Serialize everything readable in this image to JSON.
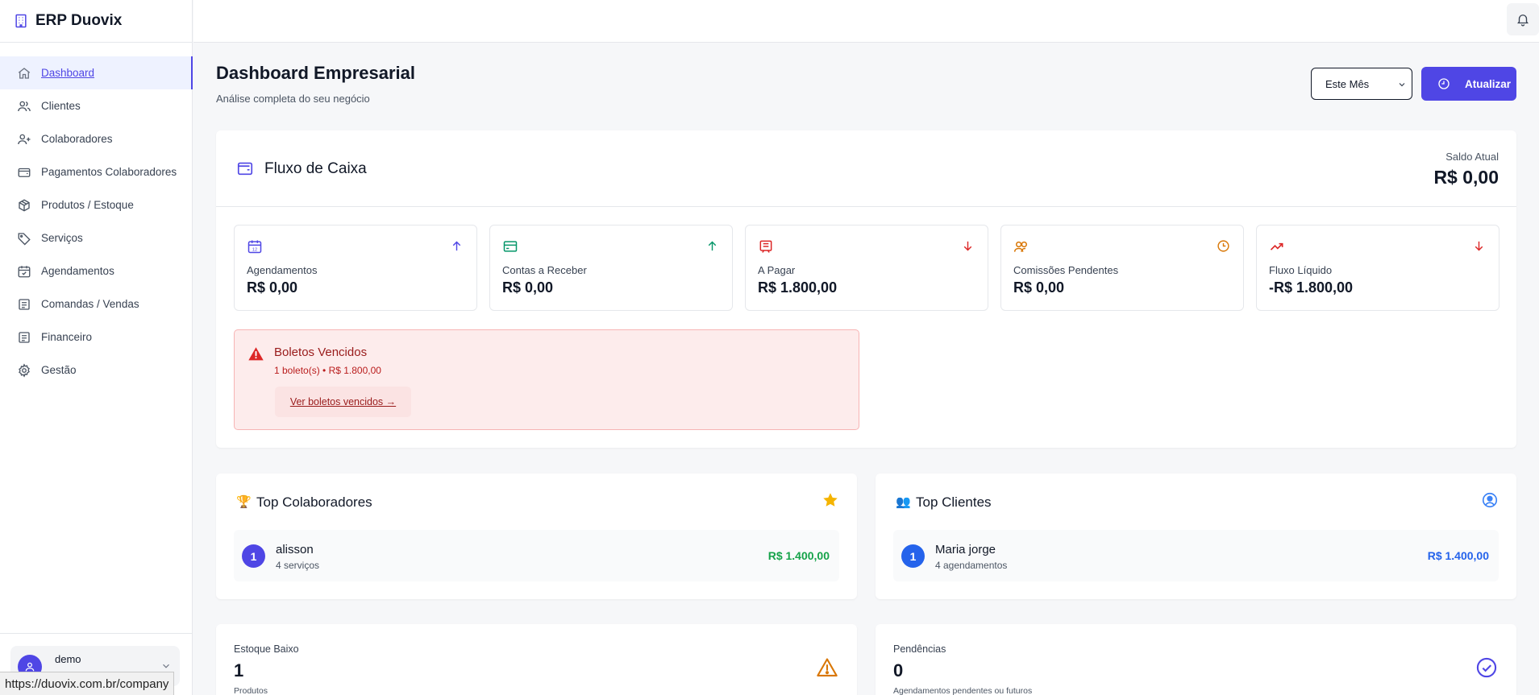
{
  "brand": {
    "title": "ERP Duovix"
  },
  "sidebar": {
    "items": [
      {
        "label": "Dashboard"
      },
      {
        "label": "Clientes"
      },
      {
        "label": "Colaboradores"
      },
      {
        "label": "Pagamentos Colaboradores"
      },
      {
        "label": "Produtos / Estoque"
      },
      {
        "label": "Serviços"
      },
      {
        "label": "Agendamentos"
      },
      {
        "label": "Comandas / Vendas"
      },
      {
        "label": "Financeiro"
      },
      {
        "label": "Gestão"
      }
    ],
    "user": {
      "name": "demo"
    }
  },
  "status_url": "https://duovix.com.br/company",
  "header": {
    "title": "Dashboard Empresarial",
    "subtitle": "Análise completa do seu negócio",
    "period": "Este Mês",
    "refresh_label": "Atualizar"
  },
  "cashflow": {
    "title": "Fluxo de Caixa",
    "balance_label": "Saldo Atual",
    "balance_value": "R$ 0,00",
    "metrics": [
      {
        "label": "Agendamentos",
        "value": "R$ 0,00",
        "icon": "calendar-icon",
        "trend": "arrow-up-icon",
        "color": "#4f46e5"
      },
      {
        "label": "Contas a Receber",
        "value": "R$ 0,00",
        "icon": "credit-card-icon",
        "trend": "arrow-up-icon",
        "color": "#059669"
      },
      {
        "label": "A Pagar",
        "value": "R$ 1.800,00",
        "icon": "receipt-icon",
        "trend": "arrow-down-icon",
        "color": "#dc2626"
      },
      {
        "label": "Comissões Pendentes",
        "value": "R$ 0,00",
        "icon": "users-icon",
        "trend": "clock-icon",
        "color": "#d97706"
      },
      {
        "label": "Fluxo Líquido",
        "value": "-R$ 1.800,00",
        "icon": "trending-up-icon",
        "trend": "arrow-down-icon",
        "color": "#dc2626"
      }
    ],
    "alert": {
      "title": "Boletos Vencidos",
      "detail": "1 boleto(s) • R$ 1.800,00",
      "link": "Ver boletos vencidos →"
    }
  },
  "top_collaborators": {
    "title": "Top Colaboradores",
    "emoji": "🏆",
    "rows": [
      {
        "rank": "1",
        "name": "alisson",
        "detail": "4 serviços",
        "value": "R$ 1.400,00"
      }
    ],
    "value_color": "#16a34a",
    "badge_color": "#4f46e5"
  },
  "top_clients": {
    "title": "Top Clientes",
    "emoji": "👥",
    "rows": [
      {
        "rank": "1",
        "name": "Maria jorge",
        "detail": "4 agendamentos",
        "value": "R$ 1.400,00"
      }
    ],
    "value_color": "#2563eb",
    "badge_color": "#2563eb"
  },
  "low_stock": {
    "label": "Estoque Baixo",
    "value": "1",
    "detail": "Produtos"
  },
  "pending": {
    "label": "Pendências",
    "value": "0",
    "detail": "Agendamentos pendentes ou futuros"
  }
}
